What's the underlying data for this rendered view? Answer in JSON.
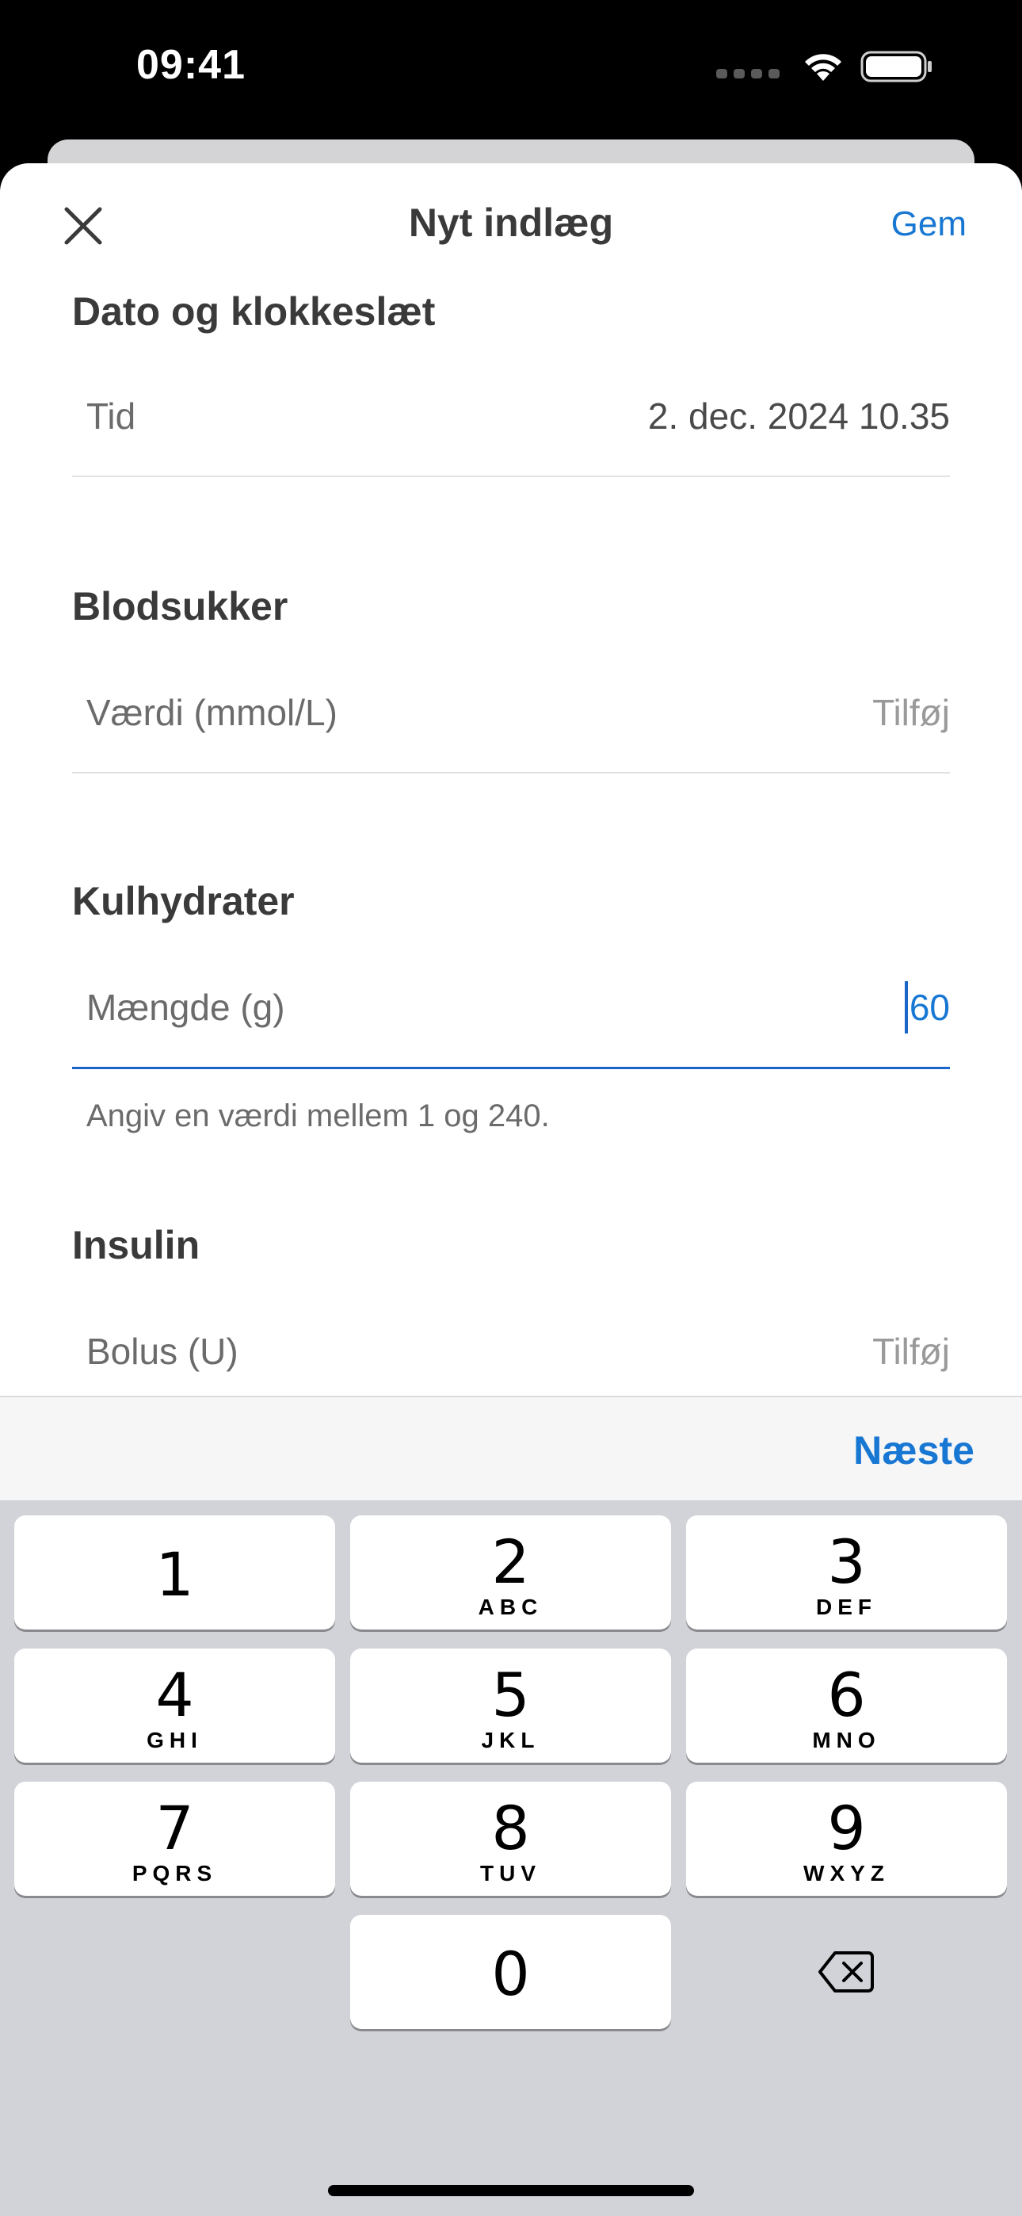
{
  "status_bar": {
    "time": "09:41"
  },
  "nav": {
    "title": "Nyt indlæg",
    "save_label": "Gem"
  },
  "sections": {
    "datetime": {
      "title": "Dato og klokkeslæt",
      "row": {
        "label": "Tid",
        "value": "2. dec. 2024 10.35"
      }
    },
    "blood_sugar": {
      "title": "Blodsukker",
      "row": {
        "label": "Værdi (mmol/L)",
        "placeholder": "Tilføj"
      }
    },
    "carbs": {
      "title": "Kulhydrater",
      "row": {
        "label": "Mængde (g)",
        "value": "60"
      },
      "hint": "Angiv en værdi mellem 1 og 240."
    },
    "insulin": {
      "title": "Insulin",
      "row": {
        "label": "Bolus (U)",
        "placeholder": "Tilføj"
      }
    }
  },
  "accessory": {
    "next_label": "Næste"
  },
  "keypad": {
    "keys": [
      {
        "digit": "1",
        "letters": ""
      },
      {
        "digit": "2",
        "letters": "ABC"
      },
      {
        "digit": "3",
        "letters": "DEF"
      },
      {
        "digit": "4",
        "letters": "GHI"
      },
      {
        "digit": "5",
        "letters": "JKL"
      },
      {
        "digit": "6",
        "letters": "MNO"
      },
      {
        "digit": "7",
        "letters": "PQRS"
      },
      {
        "digit": "8",
        "letters": "TUV"
      },
      {
        "digit": "9",
        "letters": "WXYZ"
      },
      {
        "digit": "0",
        "letters": ""
      }
    ]
  },
  "colors": {
    "accent": "#1877d3",
    "focus_underline": "#1a67c9",
    "keyboard_bg": "#d1d3d9"
  },
  "icons": {
    "close": "close-icon",
    "delete": "backspace-icon"
  }
}
